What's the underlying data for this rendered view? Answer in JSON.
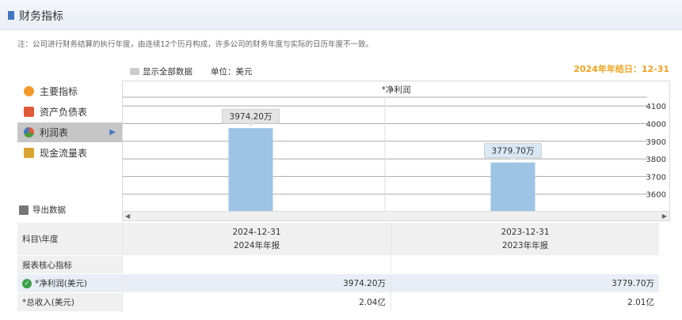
{
  "header": {
    "title": "财务指标"
  },
  "note": "注：公司进行财务结算的执行年度，由连续12个历月构成，许多公司的财务年度与实际的日历年度不一致。",
  "toolbar": {
    "show_all": "显示全部数据",
    "unit": "单位：美元",
    "year_end": "2024年年结日：12-31"
  },
  "sidebar": {
    "items": [
      {
        "label": "主要指标",
        "icon": "gear-icon",
        "color": "#f39b2a"
      },
      {
        "label": "资产负债表",
        "icon": "document-icon",
        "color": "#e05a3a"
      },
      {
        "label": "利润表",
        "icon": "pie-chart-icon",
        "color": "#4c9a3a"
      },
      {
        "label": "现金流量表",
        "icon": "money-icon",
        "color": "#d8a531"
      }
    ],
    "active_index": 2
  },
  "export_label": "导出数据",
  "chart_data": {
    "type": "bar",
    "title": "*净利润",
    "categories": [
      "2024-12-31",
      "2023-12-31"
    ],
    "values": [
      3974.2,
      3779.7
    ],
    "labels": [
      "3974.20万",
      "3779.70万"
    ],
    "ylim": [
      3500,
      4150
    ],
    "yticks": [
      3600,
      3700,
      3800,
      3900,
      4000,
      4100
    ],
    "bar_color": "#9dc4e4",
    "grid": true
  },
  "table": {
    "corner": "科目\\年度",
    "columns": [
      {
        "date": "2024-12-31",
        "report": "2024年年报"
      },
      {
        "date": "2023-12-31",
        "report": "2023年年报"
      }
    ],
    "section": "报表核心指标",
    "rows": [
      {
        "label": "*净利润(美元)",
        "values": [
          "3974.20万",
          "3779.70万"
        ],
        "highlight": true
      },
      {
        "label": "*总收入(美元)",
        "values": [
          "2.04亿",
          "2.01亿"
        ],
        "highlight": false
      }
    ]
  }
}
